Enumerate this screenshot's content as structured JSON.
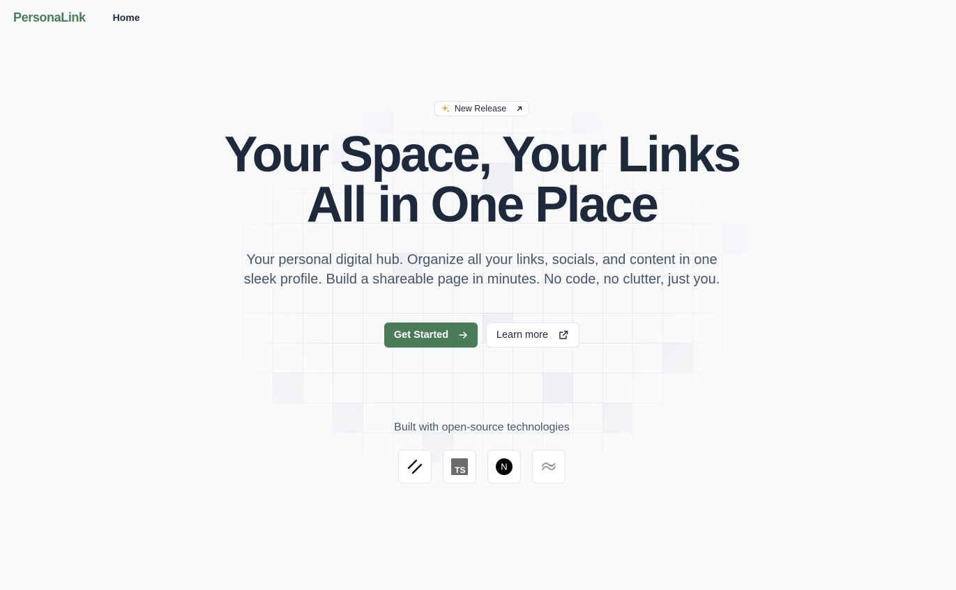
{
  "nav": {
    "logo": "PersonaLink",
    "links": [
      {
        "label": "Home"
      }
    ]
  },
  "hero": {
    "badge": {
      "label": "New Release",
      "icon": "sparkles-icon",
      "trailing_icon": "arrow-up-right-icon"
    },
    "title_line1": "Your Space, Your Links",
    "title_line2": "All in One Place",
    "subtitle_line1": "Your personal digital hub. Organize all your links, socials, and content in one",
    "subtitle_line2": "sleek profile. Build a shareable page in minutes. No code, no clutter, just you.",
    "primary_button": {
      "label": "Get Started",
      "icon": "arrow-right-icon"
    },
    "secondary_button": {
      "label": "Learn more",
      "icon": "external-link-icon"
    }
  },
  "tech": {
    "label": "Built with open-source technologies",
    "items": [
      {
        "name": "shadcn-icon"
      },
      {
        "name": "typescript-icon",
        "text": "TS"
      },
      {
        "name": "nextjs-icon",
        "text": "N"
      },
      {
        "name": "tailwind-icon"
      }
    ]
  },
  "colors": {
    "brand": "#4a7c59",
    "heading": "#1e293b",
    "body": "#475569",
    "background": "#f8f9fb"
  }
}
